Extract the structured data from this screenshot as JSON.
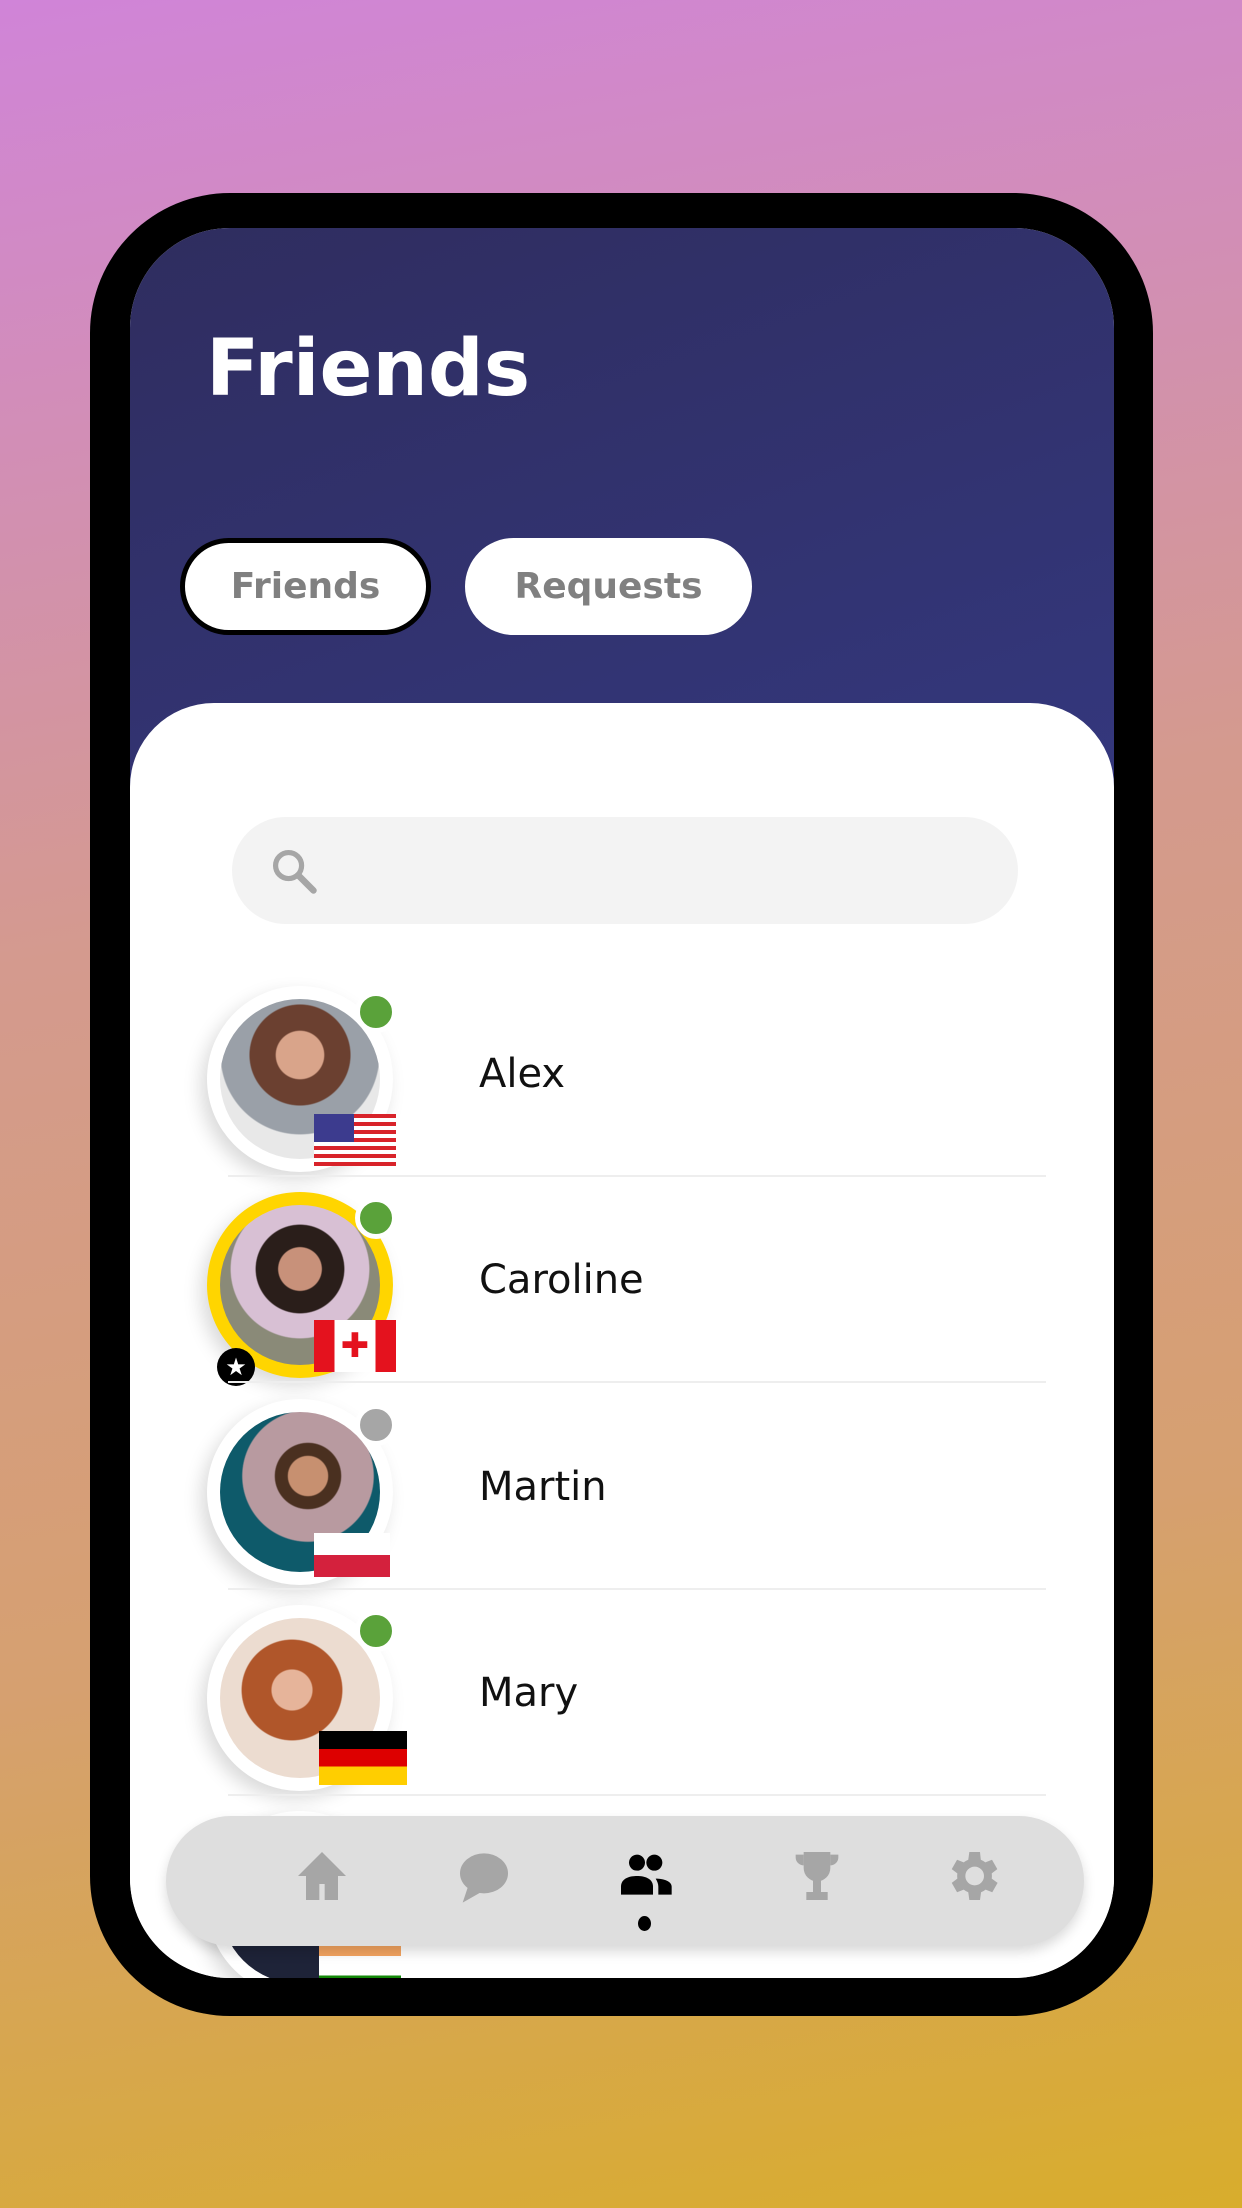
{
  "header": {
    "title": "Friends"
  },
  "tabs": [
    {
      "label": "Friends",
      "active": true
    },
    {
      "label": "Requests",
      "active": false
    }
  ],
  "search": {
    "placeholder": "",
    "icon": "search-icon"
  },
  "friends": [
    {
      "name": "Alex",
      "status": "online",
      "country": "US",
      "favorite": false
    },
    {
      "name": "Caroline",
      "status": "online",
      "country": "CA",
      "favorite": true
    },
    {
      "name": "Martin",
      "status": "offline",
      "country": "PL",
      "favorite": false
    },
    {
      "name": "Mary",
      "status": "online",
      "country": "DE",
      "favorite": false
    },
    {
      "name": "",
      "status": "",
      "country": "IN",
      "favorite": false
    }
  ],
  "nav": [
    {
      "icon": "home-icon"
    },
    {
      "icon": "chat-icon"
    },
    {
      "icon": "friends-icon",
      "active": true
    },
    {
      "icon": "trophy-icon"
    },
    {
      "icon": "settings-icon"
    }
  ],
  "colors": {
    "online": "#5aa23a",
    "offline": "#a6a6a6",
    "favorite_ring": "#ffd500",
    "header": "#33367a"
  }
}
